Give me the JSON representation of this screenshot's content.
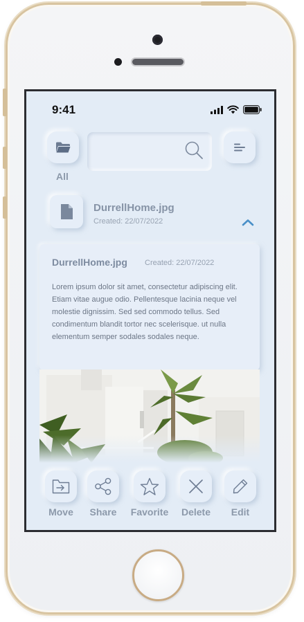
{
  "status_bar": {
    "time": "9:41"
  },
  "header": {
    "all_label": "All",
    "search": {
      "value": "",
      "placeholder": ""
    }
  },
  "file_item": {
    "name": "DurrellHome.jpg",
    "created": "Created: 22/07/2022"
  },
  "detail": {
    "title": "DurrellHome.jpg",
    "created": "Created: 22/07/2022",
    "description": "Lorem ipsum dolor sit amet, consectetur adipiscing elit. Etiam vitae augue odio. Pellentesque lacinia neque vel molestie dignissim. Sed sed commodo tellus. Sed condimentum blandit tortor nec scelerisque. ut nulla elementum semper sodales sodales neque."
  },
  "actions": [
    {
      "label": "Move",
      "icon": "move-to-folder-icon"
    },
    {
      "label": "Share",
      "icon": "share-icon"
    },
    {
      "label": "Favorite",
      "icon": "star-icon"
    },
    {
      "label": "Delete",
      "icon": "close-icon"
    },
    {
      "label": "Edit",
      "icon": "pencil-icon"
    }
  ],
  "colors": {
    "screen_bg": "#e3ecf6",
    "accent": "#4a90c8",
    "label_gray": "#8c99aa",
    "phone_gold": "#d8c4a0"
  }
}
